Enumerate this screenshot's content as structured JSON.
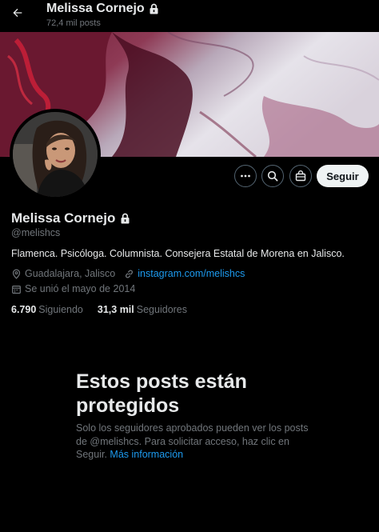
{
  "header": {
    "name": "Melissa Cornejo",
    "post_count": "72,4 mil posts"
  },
  "profile": {
    "display_name": "Melissa Cornejo",
    "handle": "@melishcs",
    "bio": "Flamenca. Psicóloga. Columnista. Consejera Estatal de Morena en Jalisco.",
    "location": "Guadalajara, Jalisco",
    "website": "instagram.com/melishcs",
    "joined": "Se unió el mayo de 2014",
    "following_count": "6.790",
    "following_label": "Siguiendo",
    "followers_count": "31,3 mil",
    "followers_label": "Seguidores"
  },
  "actions": {
    "follow_label": "Seguir"
  },
  "protected": {
    "title": "Estos posts están protegidos",
    "body": "Solo los seguidores aprobados pueden ver los posts de @melishcs. Para solicitar acceso, haz clic en Seguir.",
    "link": "Más información"
  },
  "icons": [
    "back-arrow-icon",
    "lock-icon",
    "more-icon",
    "search-icon",
    "subscribe-icon",
    "location-icon",
    "link-icon",
    "calendar-icon"
  ],
  "colors": {
    "accent": "#1d9bf0",
    "text": "#e7e9ea",
    "muted": "#71767b",
    "background": "#000000"
  }
}
